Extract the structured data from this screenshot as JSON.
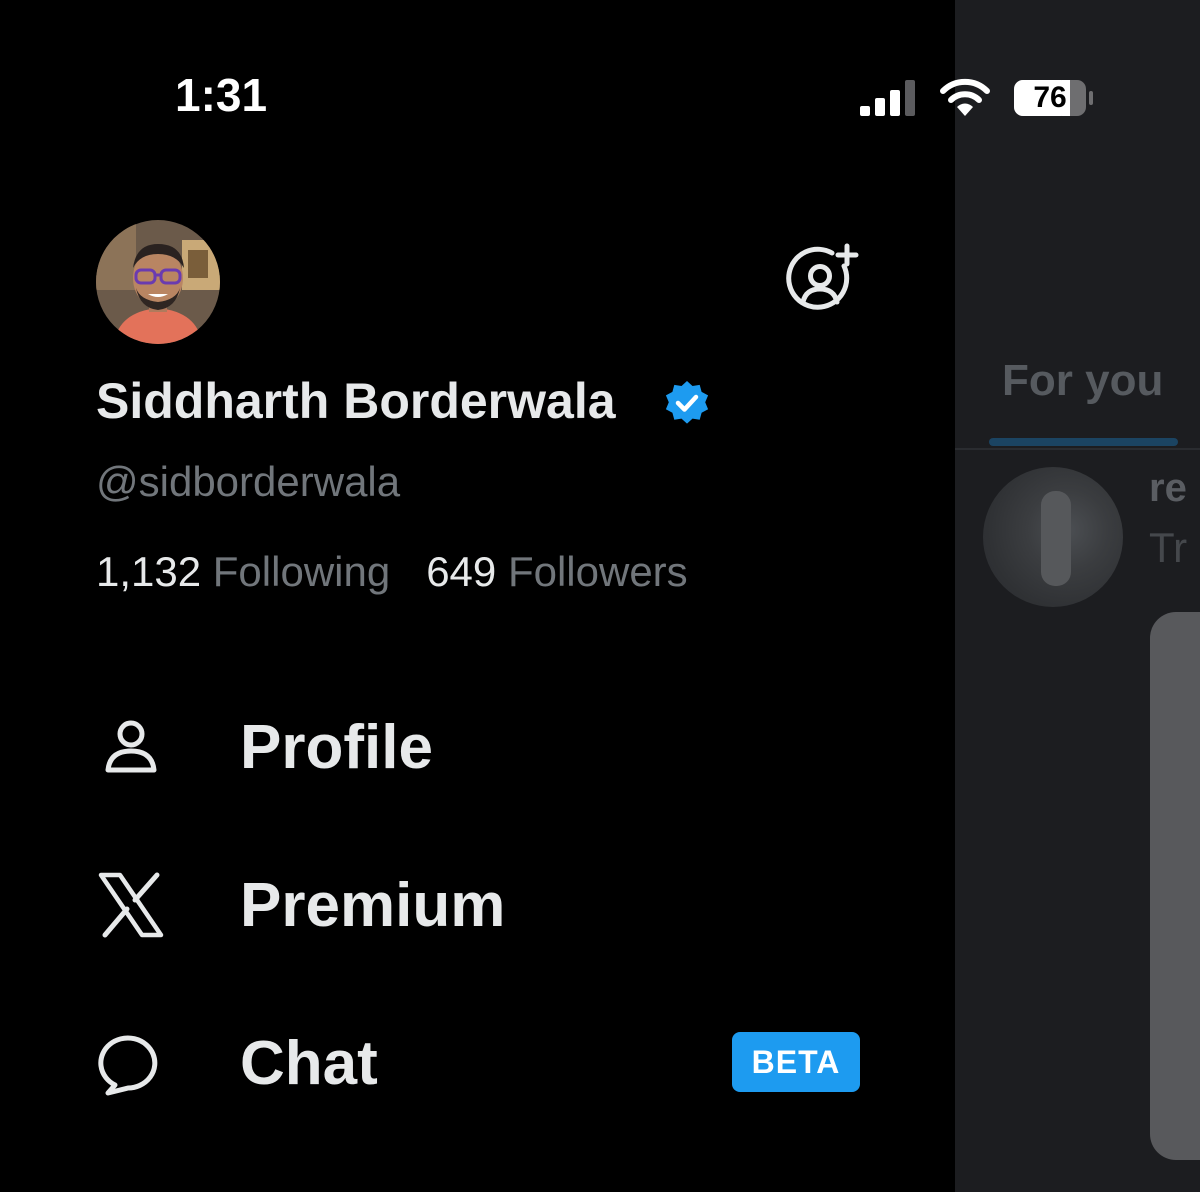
{
  "status_bar": {
    "time": "1:31",
    "battery_level": "76",
    "icons": [
      "signal-icon",
      "wifi-icon",
      "battery-icon"
    ]
  },
  "drawer": {
    "profile": {
      "display_name": "Siddharth Borderwala",
      "handle": "@sidborderwala",
      "verified": true,
      "following_count": "1,132",
      "following_label": "Following",
      "followers_count": "649",
      "followers_label": "Followers"
    },
    "menu": [
      {
        "label": "Profile",
        "icon": "person-icon"
      },
      {
        "label": "Premium",
        "icon": "x-logo-icon"
      },
      {
        "label": "Chat",
        "icon": "chat-bubble-icon",
        "badge": "BETA"
      }
    ]
  },
  "timeline": {
    "tab_label": "For you",
    "post_name_fragment": "re",
    "post_text_fragment": "Tr"
  },
  "colors": {
    "background": "#000000",
    "text_primary": "#e7e9ea",
    "text_secondary": "#71767b",
    "accent": "#1d9bf0",
    "overlay": "#1c1d20"
  }
}
